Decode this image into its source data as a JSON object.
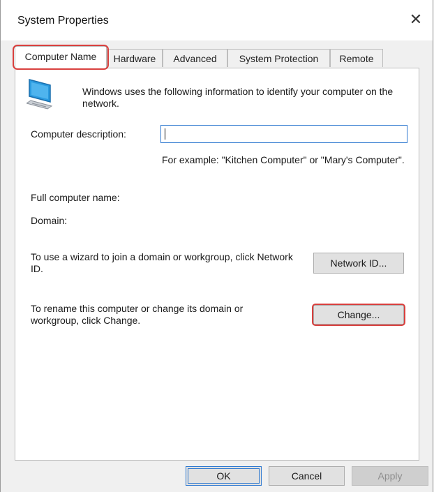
{
  "window": {
    "title": "System Properties",
    "close_glyph": "✕"
  },
  "tabs": [
    {
      "label": "Computer Name",
      "active": true
    },
    {
      "label": "Hardware"
    },
    {
      "label": "Advanced"
    },
    {
      "label": "System Protection"
    },
    {
      "label": "Remote"
    }
  ],
  "panel": {
    "icon": "computer-icon",
    "intro": "Windows uses the following information to identify your computer on the network.",
    "description_label": "Computer description:",
    "description_value": "",
    "example_text": "For example: \"Kitchen Computer\" or \"Mary's Computer\".",
    "full_name_label": "Full computer name:",
    "domain_label": "Domain:",
    "network_id_text": "To use a wizard to join a domain or workgroup, click Network ID.",
    "network_id_button": "Network ID...",
    "rename_text": "To rename this computer or change its domain or workgroup, click Change.",
    "change_button": "Change..."
  },
  "footer": {
    "ok": "OK",
    "cancel": "Cancel",
    "apply": "Apply"
  },
  "colors": {
    "highlight": "#d9403e",
    "focus_border": "#2f79d0",
    "panel_bg": "#ffffff",
    "window_bg": "#f0f0f0"
  }
}
